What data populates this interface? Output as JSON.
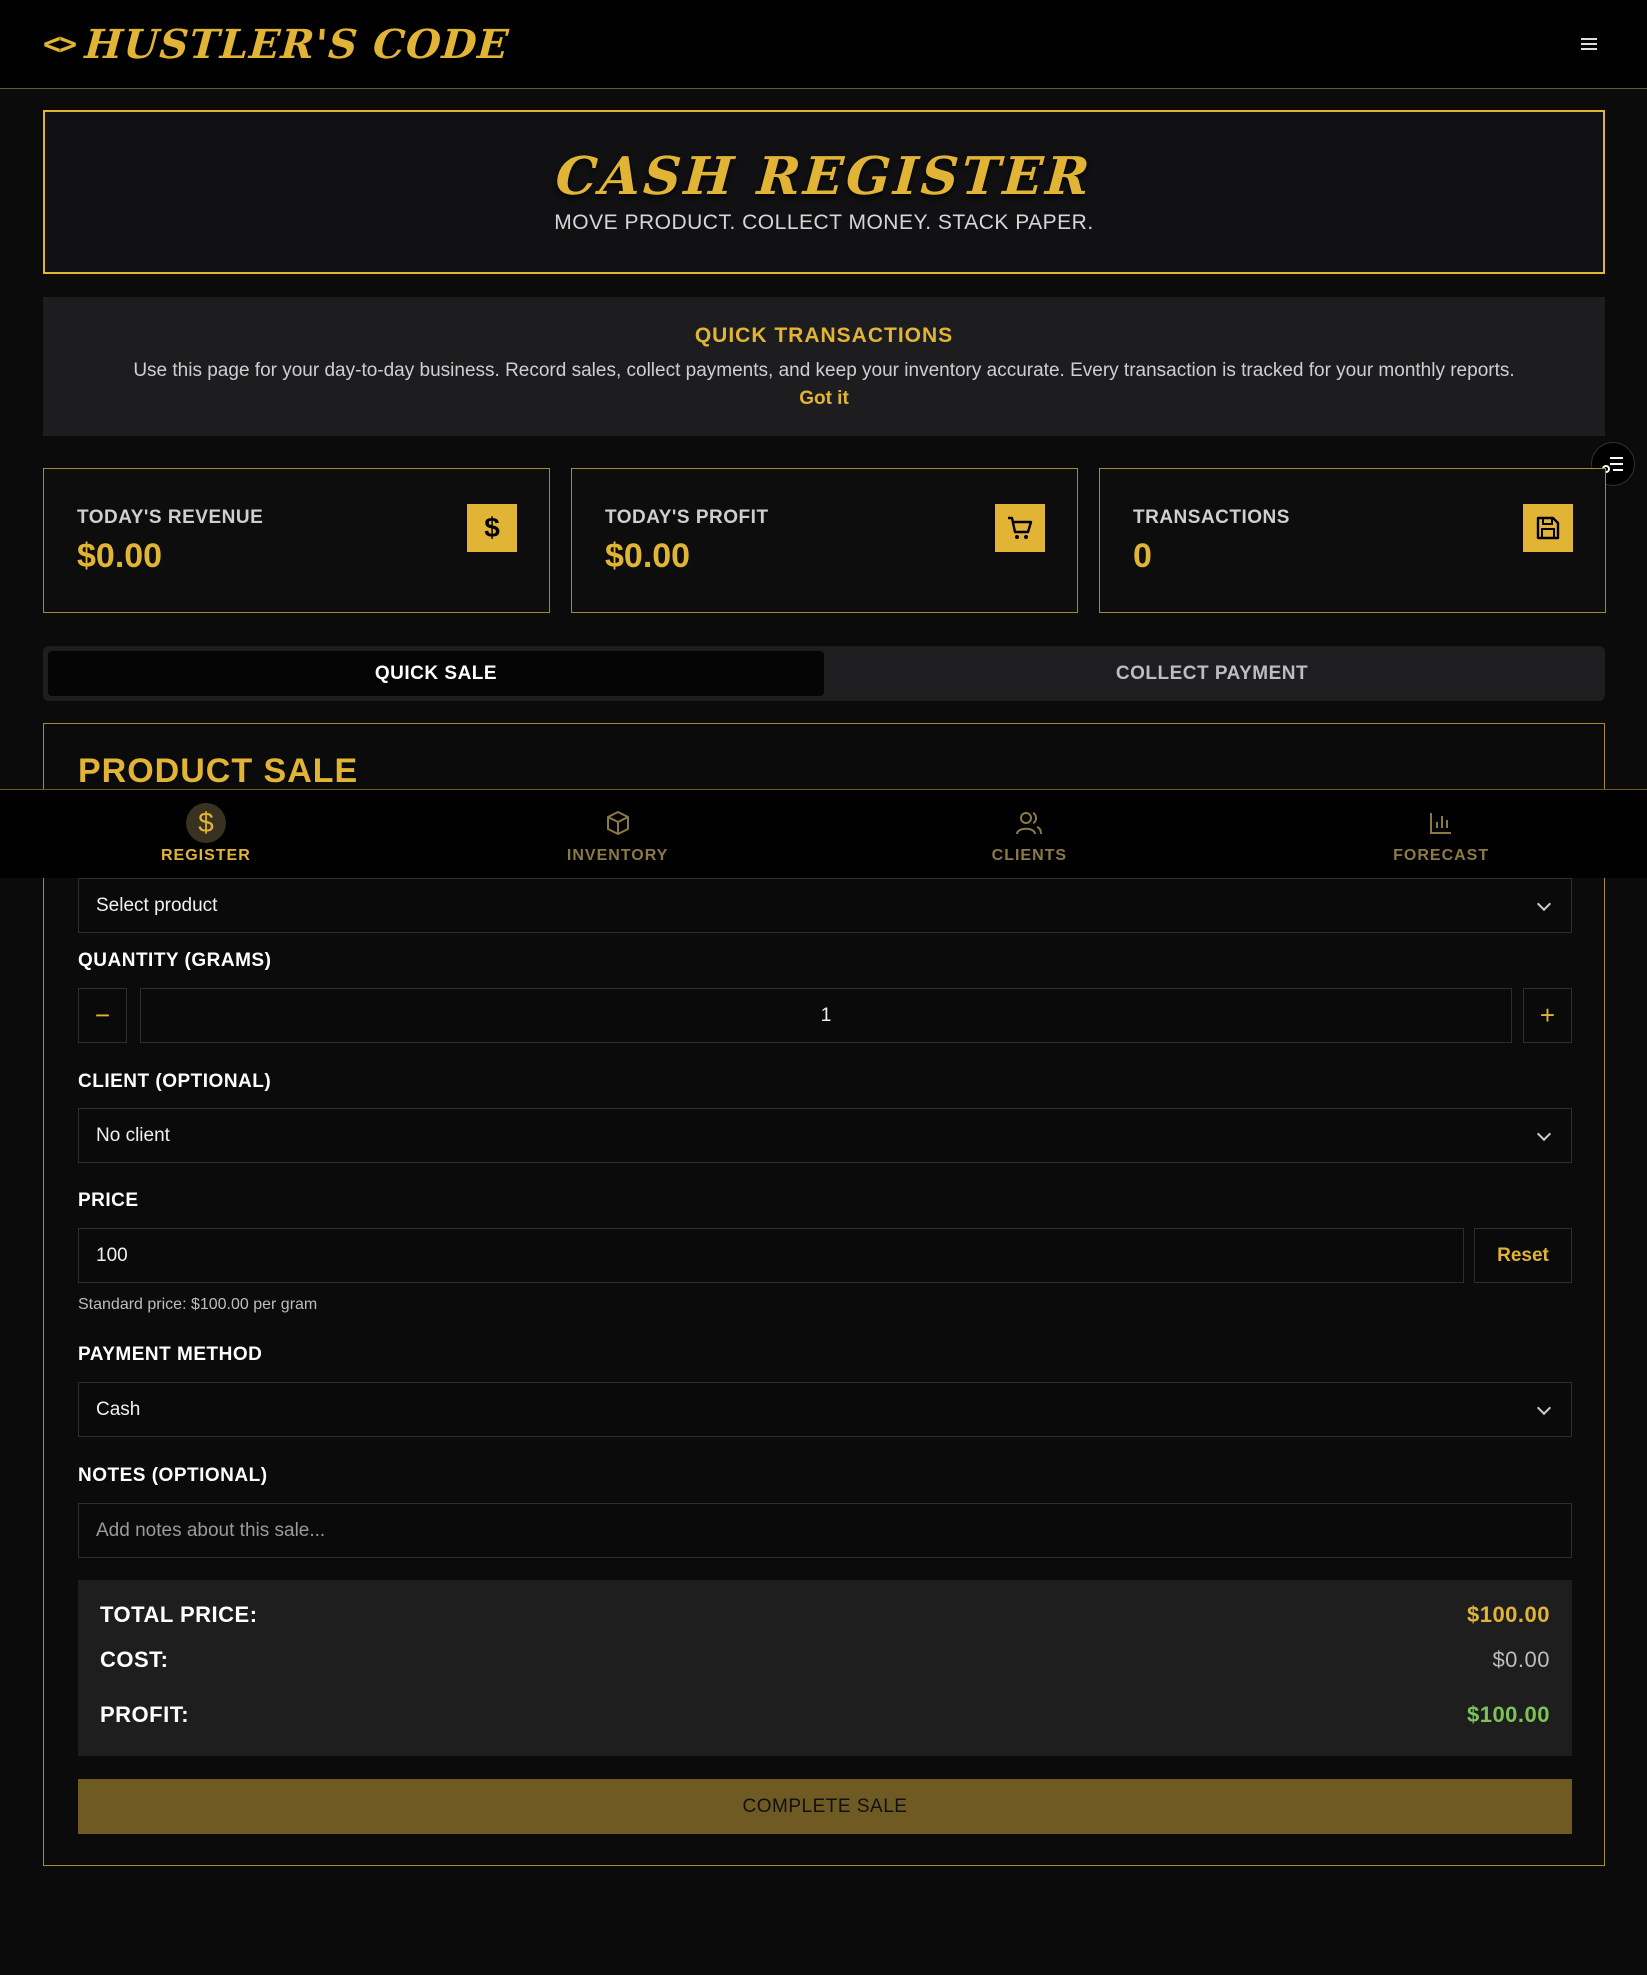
{
  "header": {
    "logo_text": "HUSTLER'S CODE",
    "logo_symbol": "<>"
  },
  "hero": {
    "title": "CASH REGISTER",
    "subtitle": "MOVE PRODUCT. COLLECT MONEY. STACK PAPER."
  },
  "info": {
    "title": "QUICK TRANSACTIONS",
    "text": "Use this page for your day-to-day business. Record sales, collect payments, and keep your inventory accurate. Every transaction is tracked for your monthly reports.",
    "dismiss": "Got it"
  },
  "stats": [
    {
      "label": "TODAY'S REVENUE",
      "value": "$0.00",
      "icon": "dollar-icon"
    },
    {
      "label": "TODAY'S PROFIT",
      "value": "$0.00",
      "icon": "cart-icon"
    },
    {
      "label": "TRANSACTIONS",
      "value": "0",
      "icon": "save-icon"
    }
  ],
  "tabs": [
    {
      "label": "QUICK SALE",
      "active": true
    },
    {
      "label": "COLLECT PAYMENT",
      "active": false
    }
  ],
  "form": {
    "title": "PRODUCT SALE",
    "product_value": "Select product",
    "quantity_label": "QUANTITY (GRAMS)",
    "quantity_value": "1",
    "minus": "−",
    "plus": "+",
    "client_label": "CLIENT (OPTIONAL)",
    "client_value": "No client",
    "price_label": "PRICE",
    "price_value": "100",
    "reset_label": "Reset",
    "price_hint": "Standard price: $100.00 per gram",
    "payment_label": "PAYMENT METHOD",
    "payment_value": "Cash",
    "notes_label": "NOTES (OPTIONAL)",
    "notes_placeholder": "Add notes about this sale..."
  },
  "summary": {
    "total_label": "TOTAL PRICE:",
    "total_value": "$100.00",
    "cost_label": "COST:",
    "cost_value": "$0.00",
    "profit_label": "PROFIT:",
    "profit_value": "$100.00",
    "submit": "COMPLETE SALE"
  },
  "bottom_nav": [
    {
      "label": "REGISTER",
      "icon": "dollar-icon",
      "active": true
    },
    {
      "label": "INVENTORY",
      "icon": "box-icon",
      "active": false
    },
    {
      "label": "CLIENTS",
      "icon": "users-icon",
      "active": false
    },
    {
      "label": "FORECAST",
      "icon": "bar-chart-icon",
      "active": false
    }
  ],
  "colors": {
    "accent": "#e2b436",
    "profit": "#7cc456",
    "background": "#0b0b0c"
  }
}
